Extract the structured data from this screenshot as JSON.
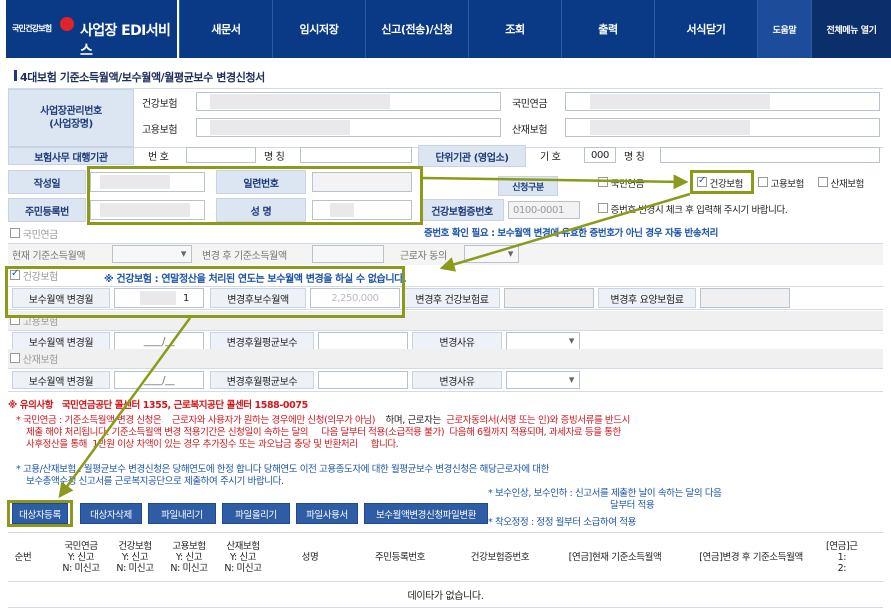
{
  "nav": {
    "logo_text": "국민건강보험",
    "service_name": "사업장 EDI서비스",
    "menus": [
      "새문서",
      "임시저장",
      "신고(전송)/신청",
      "조회",
      "출력",
      "서식닫기"
    ],
    "help": "도움말",
    "all_menu": "전체메뉴 열기"
  },
  "page_title": "4대보험 기준소득월액/보수월액/월평균보수 변경신청서",
  "employer": {
    "label": "사업장관리번호\n(사업장명)",
    "health": "건강보험",
    "pension": "국민연금",
    "employment": "고용보험",
    "industrial": "산재보험"
  },
  "agent": {
    "label": "보험사무 대행기관",
    "number_label": "번 호",
    "name_label": "명 칭",
    "unit_label": "단위기관 (영업소)",
    "unit_code_label": "기 호",
    "unit_code": "000",
    "unit_name_label": "명 칭"
  },
  "person": {
    "writer_label": "작성일",
    "serial_label": "일련번호",
    "rrn_label": "주민등록번",
    "name_label": "성 명",
    "insno_label": "건강보험증번호",
    "insno_value": "0100-0001",
    "apply_label": "신청구분",
    "opt_pension": "국민연금",
    "opt_health": "건강보험",
    "opt_employment": "고용보험",
    "opt_industrial": "산재보험",
    "cert_change": "증번호 변경시 체크 후 입력해 주시기 바랍니다.",
    "cert_warn": "증번호 확인 필요 : 보수월액 변경에 유효한 증번호가 아닌 경우 자동 반송처리"
  },
  "pension": {
    "title": "국민연금",
    "current": "현재 기준소득월액",
    "after": "변경 후 기준소득월액",
    "consent": "근로자 동의"
  },
  "health": {
    "title": "건강보험",
    "notice": "※ 건강보험 : 연말정산을 처리된 연도는 보수월액 변경을 하실 수 없습니다.",
    "change_month_label": "보수월액 변경월",
    "change_month_value": "1",
    "after_label": "변경후보수월액",
    "after_value": "2,250,000",
    "premium_label": "변경후 건강보험료",
    "ltc_label": "변경후 요양보험료"
  },
  "employment": {
    "title": "고용보험",
    "change_month_label": "보수월액 변경월",
    "change_month_value": "____/__",
    "avg_label": "변경후월평균보수",
    "reason_label": "변경사유"
  },
  "industrial": {
    "title": "산재보험",
    "change_month_label": "보수월액 변경월",
    "change_month_value": "____/__",
    "avg_label": "변경후월평균보수",
    "reason_label": "변경사유"
  },
  "notes": {
    "head_mark": "※ 유의사항",
    "head_text": "국민연금공단 콜센터 1355, 근로복지공단 콜센터 1588-0075",
    "p1a": "* 국민연금 : 기준소득월액 변경 신청은",
    "p1b": "근로자와 사용자가 원하는 경우에만 신청(의무가 아님)",
    "p1c": "하며, 근로자는",
    "p1d": "근로자동의서(서명 또는 인)와 증빙서류를 반드시",
    "p2a": "제출 해야 처리됩니다. 기준소득월액 변경 적용기간은 신청일이 속하는 달의",
    "p2b": "다음 달부터 적용(소급적용 불가)",
    "p2c": "다음해 6월까지 적용되며, 과세자료 등을 통한",
    "p3a": "사후정산을 통해",
    "p3b": "1만원 이상 차액이 있는 경우 추가징수 또는 과오납금 충당 및 반환처리",
    "p3c": "합니다.",
    "p4": "* 고용/산재보험 : 월평균보수 변경신청은 당해연도에 한정 합니다 당해연도 이전 고용종도자에 대한 월평균보수 변경신청은 해당근로자에 대한",
    "p5": "보수총액수정 신고서를 근로복지공단으로 제출하여 주시기 바랍니다.",
    "r1": "* 보수인상, 보수인하 : 신고서를 제출한 날이 속하는 달의 다음",
    "r2": "달부터 적용",
    "r3": "* 착오정정 : 정정 월부터 소급하여 적용"
  },
  "buttons": [
    "대상자등록",
    "대상자삭제",
    "파일내리기",
    "파일올리기",
    "파일사용서",
    "보수월액변경신청파일변환"
  ],
  "table": {
    "headers": [
      "순번",
      "국민연금\nY: 신고\nN: 미신고",
      "건강보험\nY: 신고\nN: 미신고",
      "고용보험\nY: 신고\nN: 미신고",
      "산재보험\nY: 신고\nN: 미신고",
      "성명",
      "주민등록번호",
      "건강보험증번호",
      "[연금]현재 기준소득월액",
      "[연금]변경 후 기준소득월액",
      "[연금]근\n1:\n2:"
    ],
    "empty": "데이타가 없습니다."
  },
  "colors": {
    "nav": "#0a3a86",
    "label_bg": "#dce6f3",
    "highlight": "#8c9a1b",
    "warning": "#d4161c",
    "button": "#2e5da6"
  }
}
